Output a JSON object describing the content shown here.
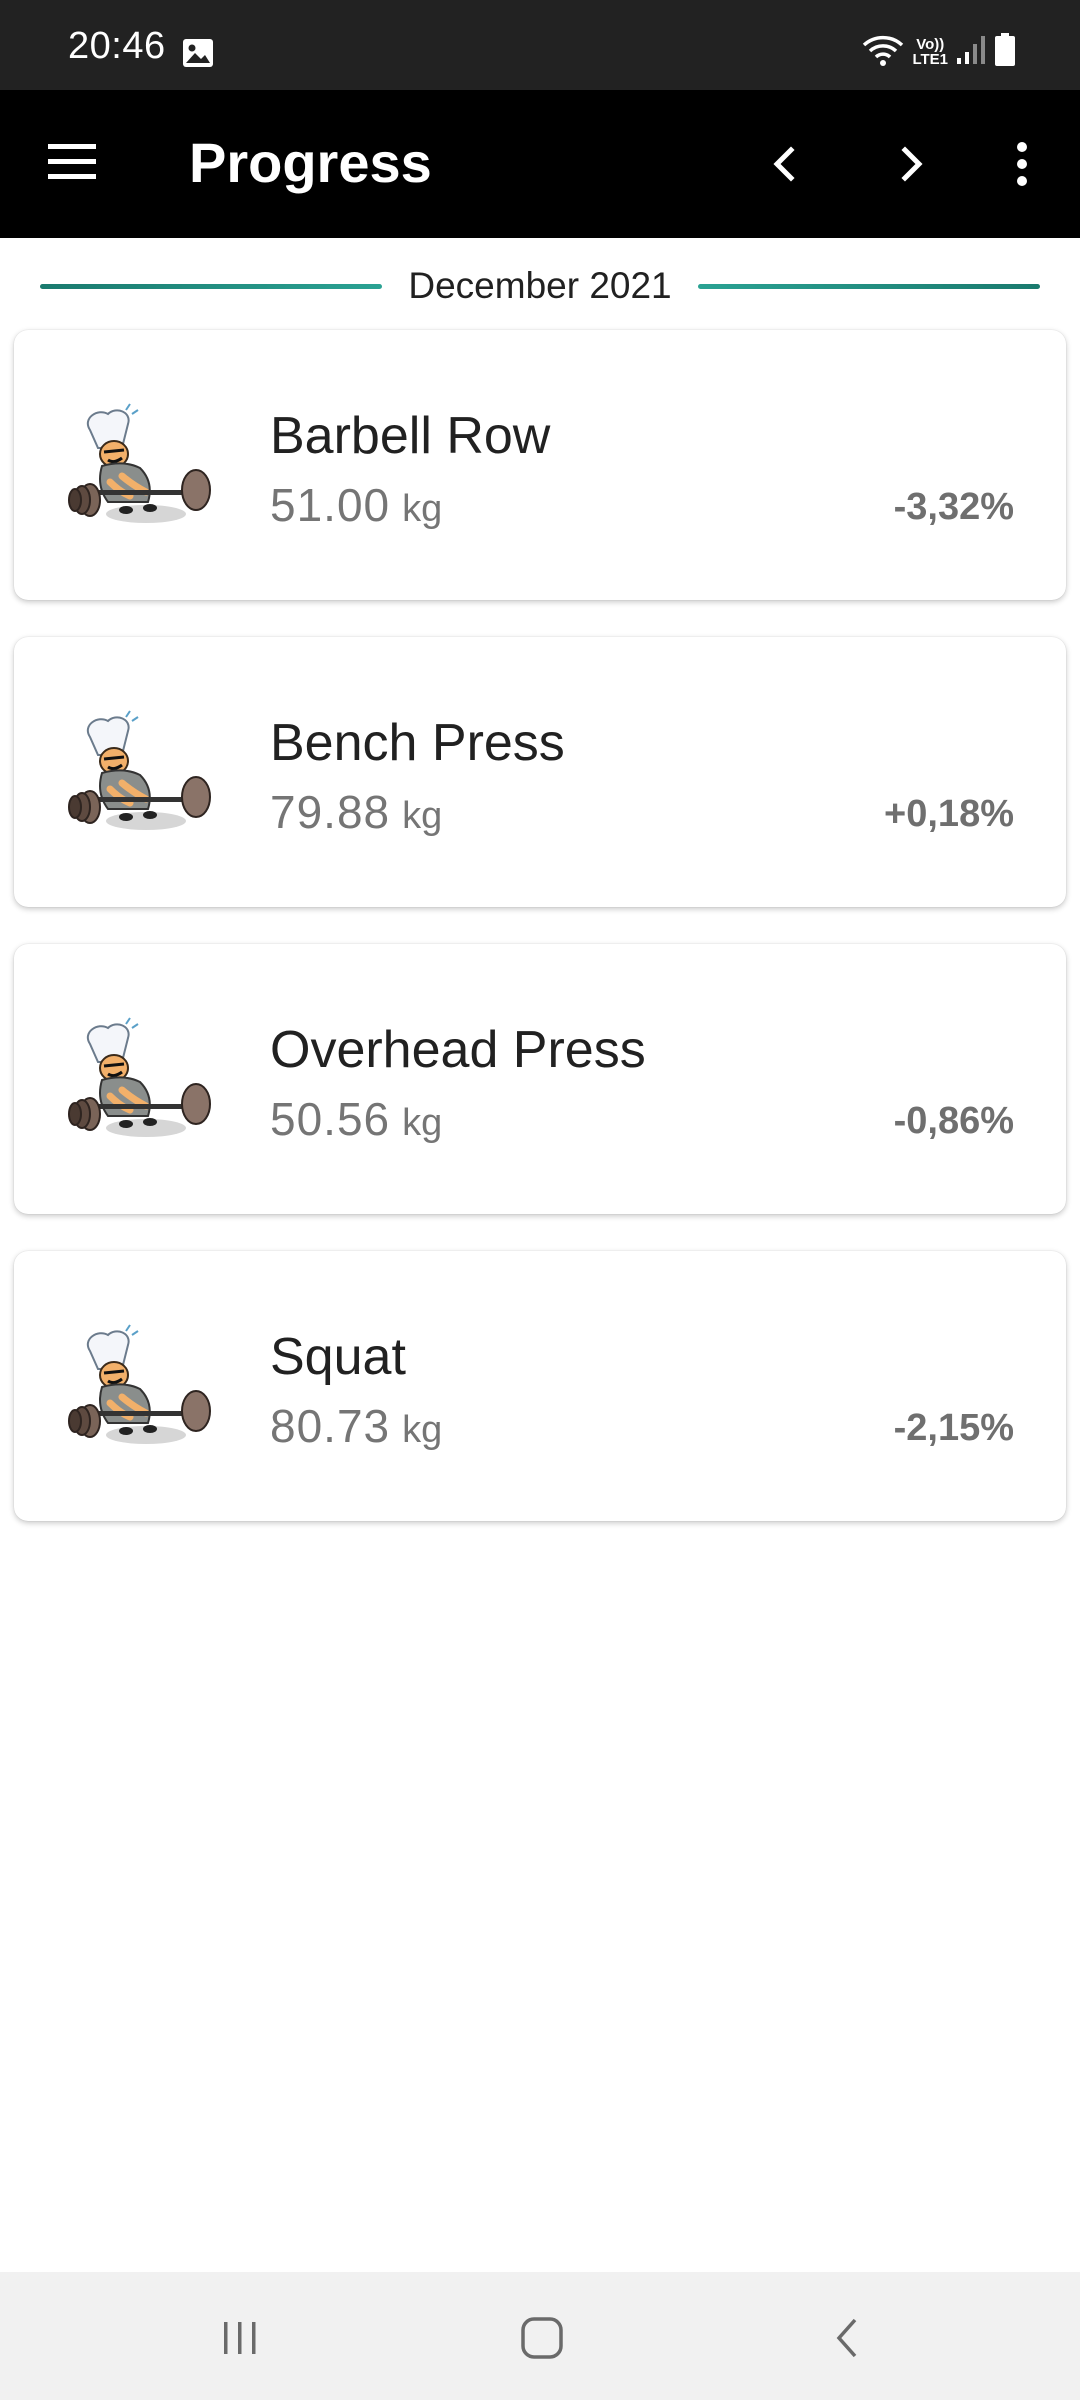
{
  "status_bar": {
    "time": "20:46",
    "volte_top": "Vo))",
    "volte_bottom": "LTE1",
    "icons": [
      "gallery-icon",
      "wifi-icon",
      "volte-icon",
      "signal-icon",
      "battery-icon"
    ]
  },
  "app_bar": {
    "title": "Progress",
    "icons": [
      "menu-icon",
      "chevron-left-icon",
      "chevron-right-icon",
      "more-vert-icon"
    ]
  },
  "month": {
    "label": "December 2021",
    "accent_color": "#1a7a6e"
  },
  "exercises": [
    {
      "name": "Barbell Row",
      "weight": "51.00",
      "unit": "kg",
      "change": "-3,32%"
    },
    {
      "name": "Bench Press",
      "weight": "79.88",
      "unit": "kg",
      "change": "+0,18%"
    },
    {
      "name": "Overhead Press",
      "weight": "50.56",
      "unit": "kg",
      "change": "-0,86%"
    },
    {
      "name": "Squat",
      "weight": "80.73",
      "unit": "kg",
      "change": "-2,15%"
    }
  ],
  "system_nav": {
    "icons": [
      "recent-apps-icon",
      "home-icon",
      "back-icon"
    ]
  }
}
